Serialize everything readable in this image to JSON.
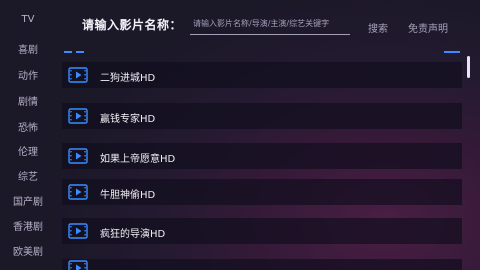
{
  "sidebar": {
    "items": [
      {
        "label": "TV"
      },
      {
        "label": "喜剧"
      },
      {
        "label": "动作"
      },
      {
        "label": "剧情"
      },
      {
        "label": "恐怖"
      },
      {
        "label": "伦理"
      },
      {
        "label": "综艺"
      },
      {
        "label": "国产剧"
      },
      {
        "label": "香港剧"
      },
      {
        "label": "欧美剧"
      }
    ]
  },
  "header": {
    "prompt": "请输入影片名称：",
    "search_placeholder": "请输入影片名称/导演/主演/综艺关键字",
    "search_button": "搜索",
    "disclaimer_button": "免责声明"
  },
  "results": {
    "items": [
      {
        "title": "二狗进城HD"
      },
      {
        "title": "赢钱专家HD"
      },
      {
        "title": "如果上帝愿意HD"
      },
      {
        "title": "牛胆神偷HD"
      },
      {
        "title": "疯狂的导演HD"
      },
      {
        "title": ""
      }
    ]
  },
  "colors": {
    "accent": "#3a8dff",
    "row_background": "#100e1e",
    "text": "#f2f0f6"
  },
  "icons": {
    "row_icon": "play-video-icon"
  }
}
